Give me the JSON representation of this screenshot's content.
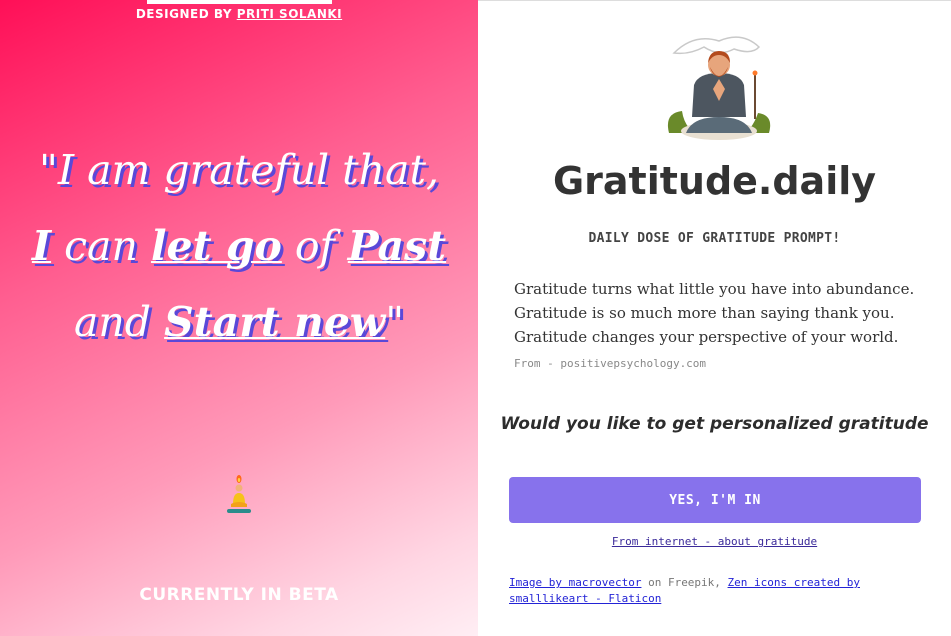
{
  "left": {
    "designed_prefix": "DESIGNED BY",
    "designer_name": "PRITI SOLANKI",
    "quote": {
      "l1": "\"I am grateful that,",
      "l2_a": "I",
      "l2_b": " can ",
      "l2_c": "let go",
      "l2_d": " of ",
      "l2_e": "Past",
      "l3_a": "and ",
      "l3_b": "Start new",
      "l3_c": "\""
    },
    "beta": "CURRENTLY IN BETA"
  },
  "right": {
    "title": "Gratitude.daily",
    "subtitle": "DAILY DOSE OF GRATITUDE PROMPT!",
    "paragraph": [
      "Gratitude turns what little you have into abundance.",
      "Gratitude is so much more than saying thank you.",
      "Gratitude changes your perspective of your world."
    ],
    "source": "From - positivepsychology.com",
    "question": "Would you like to get personalized gratitude",
    "cta": "YES, I'M IN",
    "internet_link": "From internet - about gratitude",
    "credits": {
      "image_link": "Image by macrovector",
      "middle": " on Freepik, ",
      "icons_link": "Zen icons created by smalllikeart - Flaticon"
    }
  },
  "colors": {
    "accent": "#8772ec",
    "gradient_start": "#ff0f57",
    "gradient_end": "#ffeef4"
  },
  "icons": [
    "meditating-man-illustration",
    "meditating-person-icon"
  ]
}
